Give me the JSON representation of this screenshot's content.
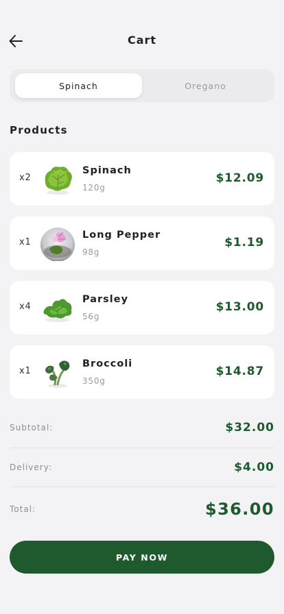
{
  "header": {
    "title": "Cart",
    "back_icon": "arrow-left-icon"
  },
  "tabs": [
    {
      "label": "Spinach",
      "active": true
    },
    {
      "label": "Oregano",
      "active": false
    }
  ],
  "products_title": "Products",
  "products": [
    {
      "qty": "x2",
      "name": "Spinach",
      "weight": "120g",
      "price": "$12.09",
      "icon": "spinach-image"
    },
    {
      "qty": "x1",
      "name": "Long Pepper",
      "weight": "98g",
      "price": "$1.19",
      "icon": "long-pepper-image"
    },
    {
      "qty": "x4",
      "name": "Parsley",
      "weight": "56g",
      "price": "$13.00",
      "icon": "parsley-image"
    },
    {
      "qty": "x1",
      "name": "Broccoli",
      "weight": "350g",
      "price": "$14.87",
      "icon": "broccoli-image"
    }
  ],
  "summary": {
    "subtotal_label": "Subtotal:",
    "subtotal_value": "$32.00",
    "delivery_label": "Delivery:",
    "delivery_value": "$4.00",
    "total_label": "Total:",
    "total_value": "$36.00"
  },
  "pay_button": {
    "label": "PAY NOW"
  },
  "colors": {
    "accent": "#1f5a2e",
    "background": "#f3f3f5",
    "card": "#ffffff",
    "muted_text": "#9a9a9e"
  }
}
